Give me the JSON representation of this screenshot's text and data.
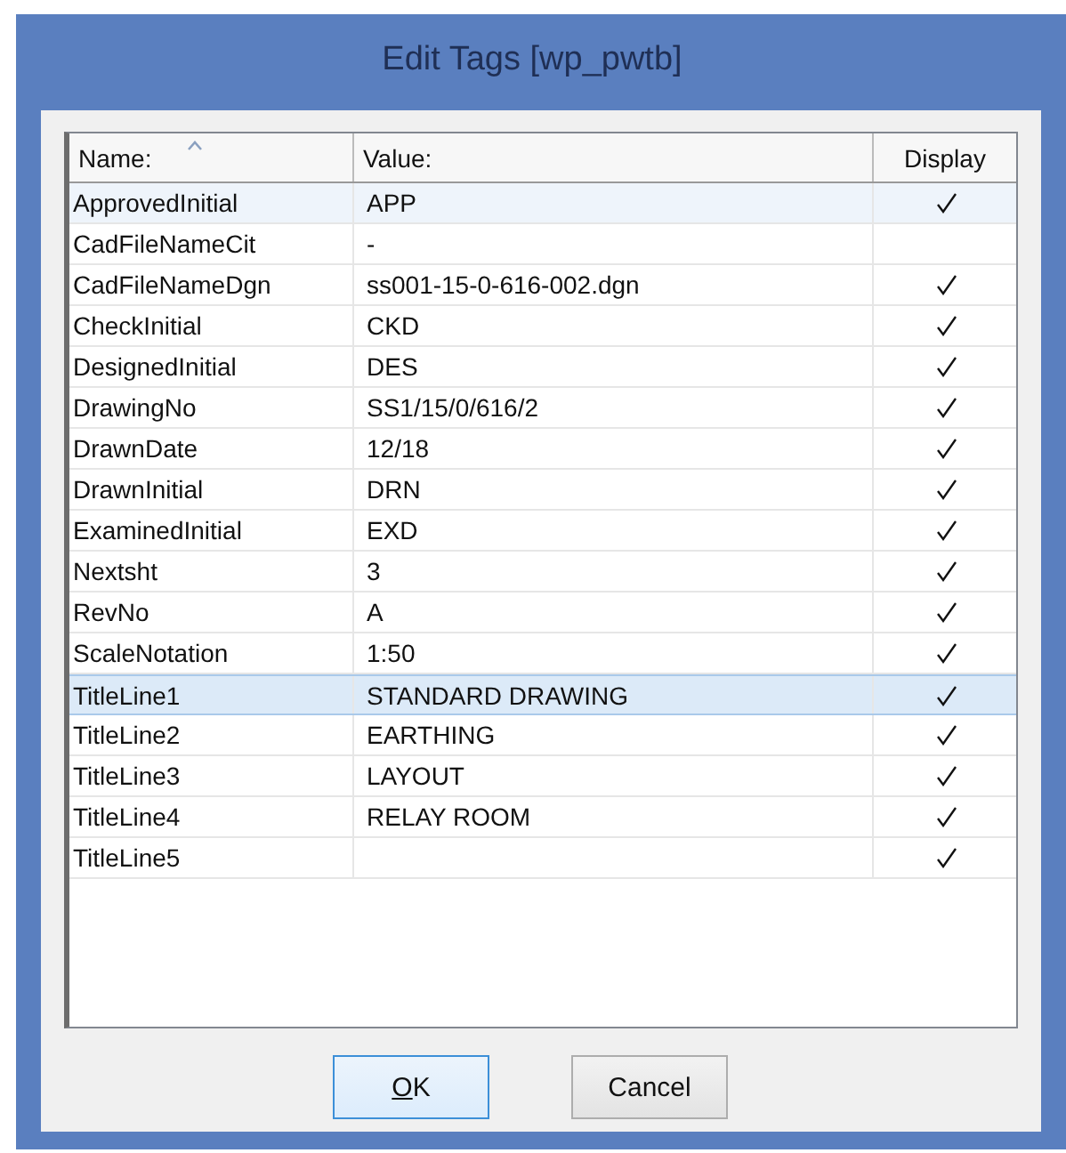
{
  "window": {
    "title": "Edit Tags [wp_pwtb]"
  },
  "table": {
    "columns": [
      {
        "label": "Name:",
        "sort_arrow": true
      },
      {
        "label": "Value:",
        "sort_arrow": false
      },
      {
        "label": "Display",
        "sort_arrow": false
      }
    ],
    "rows": [
      {
        "name": "ApprovedInitial",
        "value": "APP",
        "display": true,
        "selected": false,
        "hot": true
      },
      {
        "name": "CadFileNameCit",
        "value": "-",
        "display": false,
        "selected": false,
        "hot": false
      },
      {
        "name": "CadFileNameDgn",
        "value": "ss001-15-0-616-002.dgn",
        "display": true,
        "selected": false,
        "hot": false
      },
      {
        "name": "CheckInitial",
        "value": "CKD",
        "display": true,
        "selected": false,
        "hot": false
      },
      {
        "name": "DesignedInitial",
        "value": "DES",
        "display": true,
        "selected": false,
        "hot": false
      },
      {
        "name": "DrawingNo",
        "value": "SS1/15/0/616/2",
        "display": true,
        "selected": false,
        "hot": false
      },
      {
        "name": "DrawnDate",
        "value": "12/18",
        "display": true,
        "selected": false,
        "hot": false
      },
      {
        "name": "DrawnInitial",
        "value": "DRN",
        "display": true,
        "selected": false,
        "hot": false
      },
      {
        "name": "ExaminedInitial",
        "value": "EXD",
        "display": true,
        "selected": false,
        "hot": false
      },
      {
        "name": "Nextsht",
        "value": "3",
        "display": true,
        "selected": false,
        "hot": false
      },
      {
        "name": "RevNo",
        "value": "A",
        "display": true,
        "selected": false,
        "hot": false
      },
      {
        "name": "ScaleNotation",
        "value": "1:50",
        "display": true,
        "selected": false,
        "hot": false
      },
      {
        "name": "TitleLine1",
        "value": "STANDARD DRAWING",
        "display": true,
        "selected": true,
        "hot": false
      },
      {
        "name": "TitleLine2",
        "value": "EARTHING",
        "display": true,
        "selected": false,
        "hot": false
      },
      {
        "name": "TitleLine3",
        "value": "LAYOUT",
        "display": true,
        "selected": false,
        "hot": false
      },
      {
        "name": "TitleLine4",
        "value": "RELAY ROOM",
        "display": true,
        "selected": false,
        "hot": false
      },
      {
        "name": "TitleLine5",
        "display": true,
        "selected": false,
        "hot": false
      }
    ]
  },
  "buttons": [
    {
      "label": "OK",
      "default": true,
      "access_key_underlined": true
    },
    {
      "label": "Cancel",
      "default": false,
      "access_key_underlined": false
    }
  ]
}
